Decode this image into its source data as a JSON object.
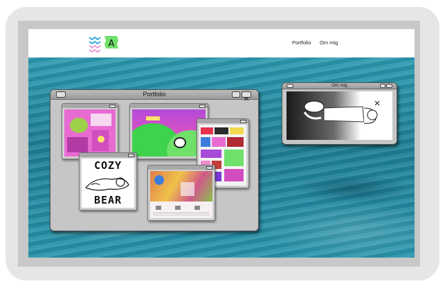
{
  "nav": {
    "items": [
      {
        "label": "Portfolio"
      },
      {
        "label": "Om mig"
      }
    ]
  },
  "logo": {
    "letter": "A"
  },
  "windows": {
    "portfolio": {
      "title": "Portfolio"
    },
    "about": {
      "title": "Om mig"
    }
  },
  "thumbnails": {
    "cozy_bear": {
      "line1": "COZY",
      "line2": "BEAR"
    }
  },
  "colors": {
    "accent_green": "#6fe06a",
    "logo_pink": "#e79ad6",
    "logo_blue": "#35a8d8",
    "sea": "#2a8ea0",
    "window_gray": "#c6c6c6"
  }
}
